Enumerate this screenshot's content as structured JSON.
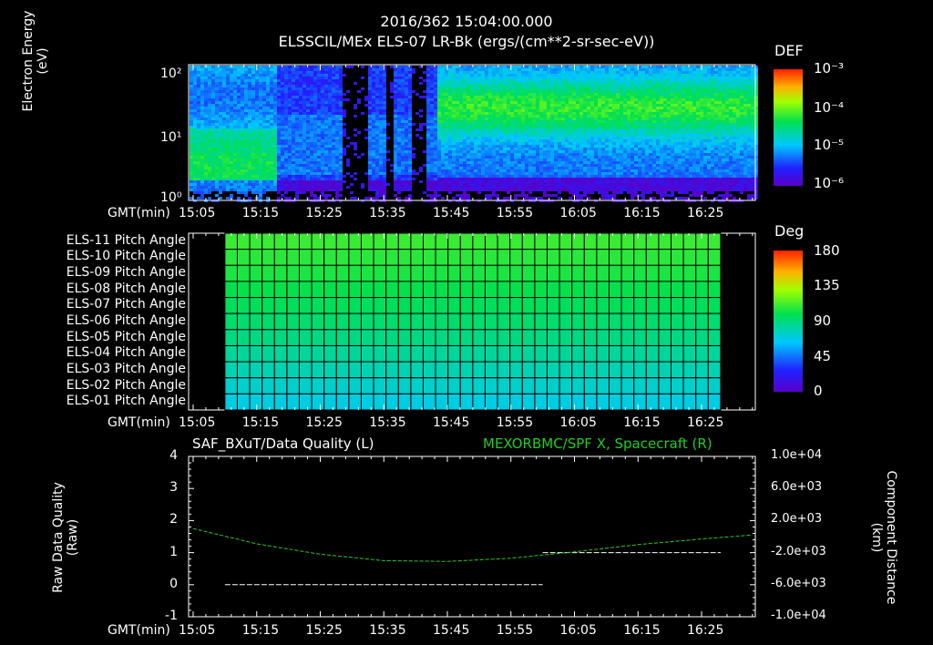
{
  "header": {
    "timestamp": "2016/362 15:04:00.000",
    "subtitle": "ELSSCIL/MEx ELS-07 LR-Bk  (ergs/(cm**2-sr-sec-eV))"
  },
  "colors": {
    "background": "#000000",
    "axis": "#ffffff",
    "spacecraft_line": "#22cc22",
    "quality_line": "#ffffff"
  },
  "panel1": {
    "ylabel_line1": "Electron Energy",
    "ylabel_line2": "(eV)",
    "yticks": [
      "10²",
      "10¹",
      "10⁰"
    ],
    "colorbar_title": "DEF",
    "colorbar_ticks": [
      "10⁻³",
      "10⁻⁴",
      "10⁻⁵",
      "10⁻⁶"
    ],
    "time_axis_label": "GMT(min)"
  },
  "panel2": {
    "row_labels": [
      "ELS-11 Pitch Angle",
      "ELS-10 Pitch Angle",
      "ELS-09 Pitch Angle",
      "ELS-08 Pitch Angle",
      "ELS-07 Pitch Angle",
      "ELS-06 Pitch Angle",
      "ELS-05 Pitch Angle",
      "ELS-04 Pitch Angle",
      "ELS-03 Pitch Angle",
      "ELS-02 Pitch Angle",
      "ELS-01 Pitch Angle"
    ],
    "colorbar_title": "Deg",
    "colorbar_ticks": [
      "180",
      "135",
      "90",
      "45",
      "0"
    ],
    "time_axis_label": "GMT(min)"
  },
  "panel3": {
    "left_title": "SAF_BXuT/Data Quality (L)",
    "right_title": "MEXORBMC/SPF X, Spacecraft (R)",
    "ylabel_left_line1": "Raw Data Quality",
    "ylabel_left_line2": "(Raw)",
    "ylabel_right_line1": "Component Distance",
    "ylabel_right_line2": "(km)",
    "yticks_left": [
      "4",
      "3",
      "2",
      "1",
      "0",
      "-1"
    ],
    "yticks_right": [
      "1.0e+04",
      "6.0e+03",
      "2.0e+03",
      "-2.0e+03",
      "-6.0e+03",
      "-1.0e+04"
    ],
    "time_axis_label": "GMT(min)"
  },
  "time_ticks": [
    "15:05",
    "15:15",
    "15:25",
    "15:35",
    "15:45",
    "15:55",
    "16:05",
    "16:15",
    "16:25"
  ],
  "chart_data": [
    {
      "type": "heatmap",
      "title": "ELSSCIL/MEx ELS-07 LR-Bk  (ergs/(cm**2-sr-sec-eV))",
      "xlabel": "GMT(min)",
      "ylabel": "Electron Energy (eV)",
      "x_range": [
        "15:05",
        "16:33"
      ],
      "ylim": [
        1,
        150
      ],
      "yscale": "log",
      "colorbar": {
        "label": "DEF",
        "scale": "log",
        "range": [
          1e-06,
          0.001
        ]
      }
    },
    {
      "type": "heatmap",
      "xlabel": "GMT(min)",
      "categories": [
        "ELS-11",
        "ELS-10",
        "ELS-09",
        "ELS-08",
        "ELS-07",
        "ELS-06",
        "ELS-05",
        "ELS-04",
        "ELS-03",
        "ELS-02",
        "ELS-01"
      ],
      "data_range_time": [
        "15:10",
        "16:28"
      ],
      "pitch_angle_deg": [
        110,
        107,
        104,
        100,
        97,
        93,
        89,
        84,
        79,
        74,
        69
      ],
      "colorbar": {
        "label": "Deg",
        "range": [
          0,
          180
        ]
      }
    },
    {
      "type": "line",
      "xlabel": "GMT(min)",
      "series": [
        {
          "name": "SAF_BXuT/Data Quality (L)",
          "axis": "left",
          "segments": [
            {
              "x": [
                "15:10",
                "16:00"
              ],
              "y": [
                0,
                0
              ]
            },
            {
              "x": [
                "16:00",
                "16:28"
              ],
              "y": [
                1,
                1
              ]
            }
          ]
        },
        {
          "name": "MEXORBMC/SPF X, Spacecraft (R)",
          "axis": "right",
          "x": [
            "15:05",
            "15:15",
            "15:25",
            "15:35",
            "15:45",
            "15:55",
            "16:05",
            "16:15",
            "16:25",
            "16:33"
          ],
          "y": [
            1000,
            -900,
            -2200,
            -3000,
            -3100,
            -2700,
            -1900,
            -1000,
            -300,
            200
          ]
        }
      ],
      "ylim_left": [
        -1,
        4
      ],
      "ylim_right": [
        -10000,
        10000
      ]
    }
  ]
}
